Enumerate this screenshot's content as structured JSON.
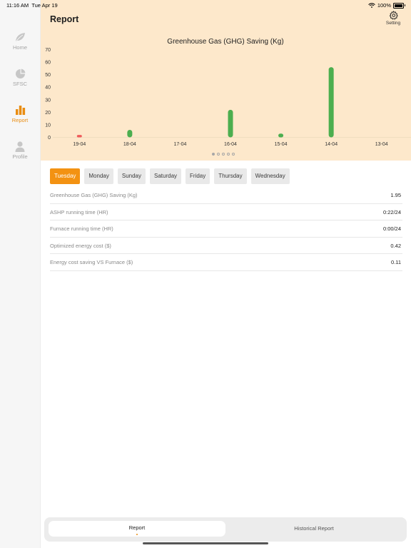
{
  "status": {
    "time": "11:16 AM",
    "date": "Tue Apr 19",
    "battery": "100%"
  },
  "sidebar": {
    "items": [
      {
        "label": "Home",
        "icon": "leaf-icon",
        "active": false
      },
      {
        "label": "SFSC",
        "icon": "pie-chart-icon",
        "active": false
      },
      {
        "label": "Report",
        "icon": "bar-chart-icon",
        "active": true
      },
      {
        "label": "Profile",
        "icon": "person-icon",
        "active": false
      }
    ]
  },
  "header": {
    "title": "Report",
    "setting_label": "Setting"
  },
  "chart_data": {
    "type": "bar",
    "title": "Greenhouse Gas (GHG) Saving (Kg)",
    "categories": [
      "19-04",
      "18-04",
      "17-04",
      "16-04",
      "15-04",
      "14-04",
      "13-04"
    ],
    "values": [
      1.95,
      6,
      0,
      22,
      3,
      56,
      0
    ],
    "bar_colors": [
      "#ef5b5b",
      "#4cae4f",
      "#4cae4f",
      "#4cae4f",
      "#4cae4f",
      "#4cae4f",
      "#4cae4f"
    ],
    "ylim": [
      0,
      70
    ],
    "yticks": [
      0,
      10,
      20,
      30,
      40,
      50,
      60,
      70
    ],
    "grid": false
  },
  "pager": {
    "count": 5,
    "active": 0
  },
  "tabs": [
    "Tuesday",
    "Monday",
    "Sunday",
    "Saturday",
    "Friday",
    "Thursday",
    "Wednesday"
  ],
  "active_tab": 0,
  "rows": [
    {
      "label": "Greenhouse Gas (GHG) Saving (Kg)",
      "value": "1.95"
    },
    {
      "label": "ASHP running time (HR)",
      "value": "0:22/24"
    },
    {
      "label": "Furnace running time (HR)",
      "value": "0:00/24"
    },
    {
      "label": "Optimized energy cost ($)",
      "value": "0.42"
    },
    {
      "label": "Energy cost saving VS Furnace ($)",
      "value": "0.11"
    }
  ],
  "bottom_tabs": {
    "report": "Report",
    "historical": "Historical Report"
  },
  "colors": {
    "accent": "#f39212",
    "header_bg": "#fde8cb",
    "bar": "#4cae4f",
    "bar_today": "#ef5b5b"
  }
}
